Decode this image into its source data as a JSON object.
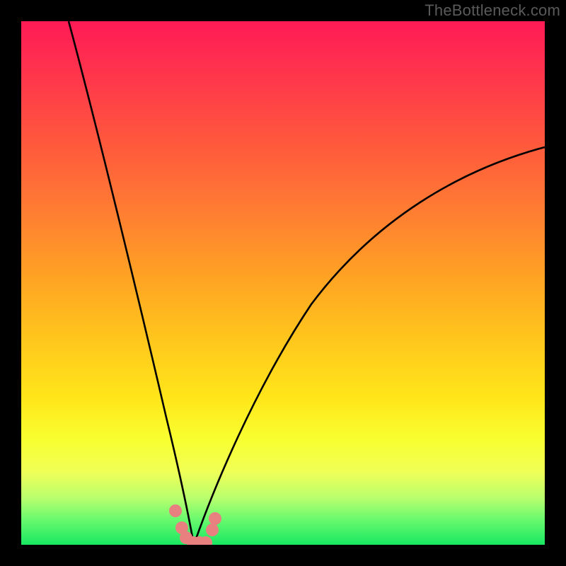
{
  "watermark": "TheBottleneck.com",
  "colors": {
    "frame": "#000000",
    "curve": "#000000",
    "marker": "#e98080",
    "gradient_top": "#ff1a56",
    "gradient_bottom": "#18e862"
  },
  "chart_data": {
    "type": "line",
    "title": "",
    "xlabel": "",
    "ylabel": "",
    "xlim": [
      0,
      100
    ],
    "ylim": [
      0,
      100
    ],
    "description": "Two dark curves descend from the top edges to a common minimum near the bottom, forming a V shape on a vertical red→orange→yellow→green heat gradient. A small cluster of rounded pink markers sits at the trough.",
    "series": [
      {
        "name": "left-curve",
        "x": [
          9,
          12,
          15,
          18,
          21,
          23,
          25,
          27,
          28.5,
          30,
          31,
          32,
          33
        ],
        "y": [
          100,
          86,
          72,
          58,
          44,
          34,
          24,
          15,
          9,
          4,
          1.5,
          0.5,
          0
        ]
      },
      {
        "name": "right-curve",
        "x": [
          33,
          35,
          38,
          42,
          48,
          55,
          63,
          72,
          82,
          92,
          100
        ],
        "y": [
          0,
          5,
          14,
          24,
          36,
          47,
          56,
          63,
          69,
          73,
          76
        ]
      }
    ],
    "markers": {
      "name": "trough-markers",
      "color": "#e98080",
      "points": [
        {
          "x": 29.5,
          "y": 6.5
        },
        {
          "x": 30.7,
          "y": 3.2
        },
        {
          "x": 31.5,
          "y": 1.2
        },
        {
          "x": 32.8,
          "y": 0.3
        },
        {
          "x": 34.0,
          "y": 0.3
        },
        {
          "x": 35.3,
          "y": 0.3
        },
        {
          "x": 36.5,
          "y": 2.8
        },
        {
          "x": 37.0,
          "y": 5.0
        }
      ]
    }
  }
}
